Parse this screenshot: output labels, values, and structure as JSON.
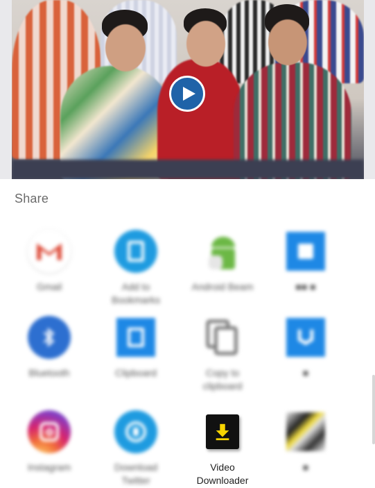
{
  "share": {
    "title": "Share"
  },
  "apps": [
    {
      "label": "Gmail",
      "icon": "gmail-icon"
    },
    {
      "label": "Add to\nBookmarks",
      "icon": "bookmark-icon"
    },
    {
      "label": "Android Beam",
      "icon": "android-icon"
    },
    {
      "label": "■■ ■",
      "icon": "app-icon"
    },
    {
      "label": "Bluetooth",
      "icon": "bluetooth-icon"
    },
    {
      "label": "Clipboard",
      "icon": "clipboard-icon"
    },
    {
      "label": "Copy to\nclipboard",
      "icon": "copy-icon"
    },
    {
      "label": "■",
      "icon": "app-icon"
    },
    {
      "label": "Instagram",
      "icon": "instagram-icon"
    },
    {
      "label": "Download\nTwitter",
      "icon": "download-twitter-icon"
    },
    {
      "label": "Video\nDownloader",
      "icon": "video-downloader-icon"
    },
    {
      "label": "■",
      "icon": "app-icon"
    }
  ],
  "colors": {
    "accent_blue": "#1e88e5",
    "play_blue": "#1f63a8",
    "video_downloader_bg": "#111111",
    "video_downloader_arrow": "#f7d400"
  }
}
